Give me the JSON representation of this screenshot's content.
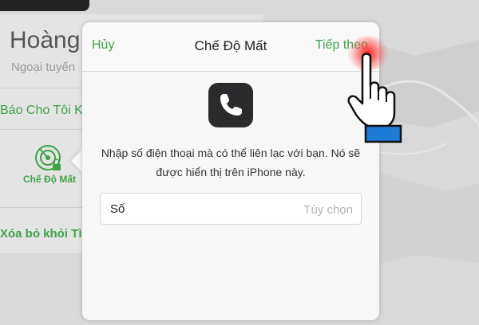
{
  "background": {
    "device_name": "Hoàng Quốc",
    "device_status": "Ngoại tuyến",
    "notify_label": "Báo Cho Tôi Khi Được Tìm Thấy",
    "lost_mode_label": "Chế Độ Mất",
    "remove_label": "Xóa bỏ khỏi Tìm iPhone"
  },
  "dialog": {
    "cancel_label": "Hủy",
    "title": "Chế Độ Mất",
    "next_label": "Tiếp theo",
    "icon": "phone-icon",
    "instruction": "Nhập số điện thoại mà có thể liên lạc với bạn. Nó sẽ được hiển thị trên iPhone này.",
    "field": {
      "label": "Số",
      "value": "",
      "placeholder": "Tùy chọn"
    }
  },
  "colors": {
    "accent": "#3fa248",
    "phone_tile": "#2b2b2d",
    "cursor_cuff": "#1e7bd6",
    "click_highlight": "#ff1e1e"
  }
}
